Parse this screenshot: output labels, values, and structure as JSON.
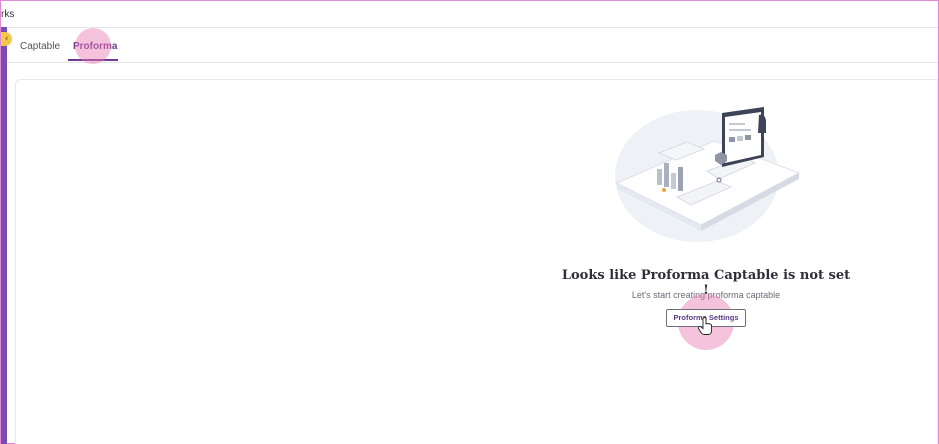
{
  "topbar": {
    "title": "rks"
  },
  "tabs": [
    {
      "label": "Captable"
    },
    {
      "label": "Proforma"
    }
  ],
  "empty_state": {
    "title": "Looks like Proforma Captable is not set !",
    "subtitle": "Let's start creating proforma captable",
    "button_label": "Proforma Settings",
    "illustration": "isometric-dashboard-illustration"
  },
  "icons": {
    "collapse": "chevron-left-icon",
    "cursor": "hand-pointer-icon"
  },
  "colors": {
    "accent": "#6f3c8f",
    "rail": "#7b4cb6",
    "collapse_button": "#f2c94c",
    "click_highlight": "#e878b0"
  }
}
